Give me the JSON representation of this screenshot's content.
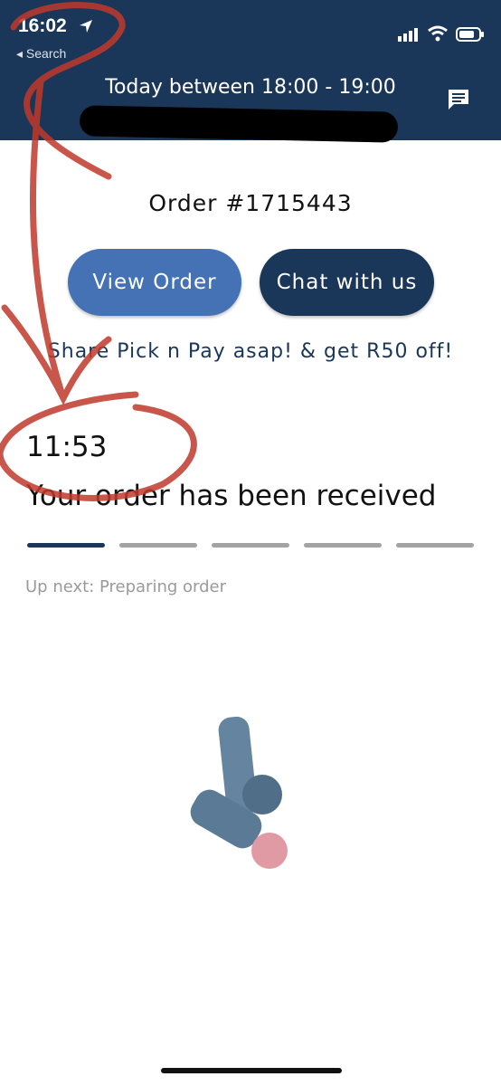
{
  "status_bar": {
    "time": "16:02",
    "back_label": "◂ Search",
    "icons": [
      "location-arrow-icon",
      "cellular-signal-icon",
      "wifi-icon",
      "battery-icon"
    ]
  },
  "header": {
    "delivery_window": "Today between 18:00 - 19:00",
    "icon": "chat-message-icon"
  },
  "order": {
    "number": "Order #1715443",
    "view_button": "View Order",
    "chat_button": "Chat with us",
    "promo": "Share Pick n Pay asap! & get R50 off!"
  },
  "tracking": {
    "time": "11:53",
    "status": "Your order has been received",
    "steps_total": 5,
    "steps_completed": 1,
    "up_next": "Up next: Preparing order"
  },
  "colors": {
    "header_bg": "#1a3658",
    "accent_blue": "#4472b5",
    "progress_done": "#1a3658",
    "progress_pending": "#a3a3a3",
    "annotation_red": "#c0392b"
  }
}
